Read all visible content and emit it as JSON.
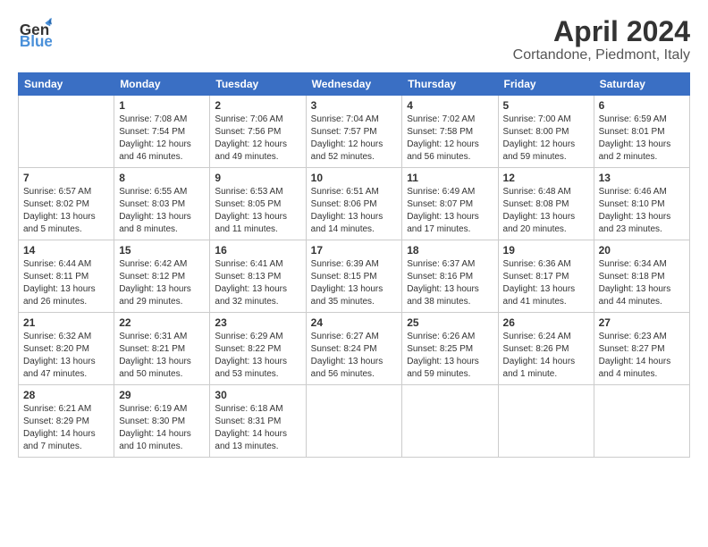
{
  "header": {
    "logo_line1": "General",
    "logo_line2": "Blue",
    "month_title": "April 2024",
    "location": "Cortandone, Piedmont, Italy"
  },
  "days_of_week": [
    "Sunday",
    "Monday",
    "Tuesday",
    "Wednesday",
    "Thursday",
    "Friday",
    "Saturday"
  ],
  "weeks": [
    [
      {
        "day": "",
        "info": ""
      },
      {
        "day": "1",
        "info": "Sunrise: 7:08 AM\nSunset: 7:54 PM\nDaylight: 12 hours\nand 46 minutes."
      },
      {
        "day": "2",
        "info": "Sunrise: 7:06 AM\nSunset: 7:56 PM\nDaylight: 12 hours\nand 49 minutes."
      },
      {
        "day": "3",
        "info": "Sunrise: 7:04 AM\nSunset: 7:57 PM\nDaylight: 12 hours\nand 52 minutes."
      },
      {
        "day": "4",
        "info": "Sunrise: 7:02 AM\nSunset: 7:58 PM\nDaylight: 12 hours\nand 56 minutes."
      },
      {
        "day": "5",
        "info": "Sunrise: 7:00 AM\nSunset: 8:00 PM\nDaylight: 12 hours\nand 59 minutes."
      },
      {
        "day": "6",
        "info": "Sunrise: 6:59 AM\nSunset: 8:01 PM\nDaylight: 13 hours\nand 2 minutes."
      }
    ],
    [
      {
        "day": "7",
        "info": "Sunrise: 6:57 AM\nSunset: 8:02 PM\nDaylight: 13 hours\nand 5 minutes."
      },
      {
        "day": "8",
        "info": "Sunrise: 6:55 AM\nSunset: 8:03 PM\nDaylight: 13 hours\nand 8 minutes."
      },
      {
        "day": "9",
        "info": "Sunrise: 6:53 AM\nSunset: 8:05 PM\nDaylight: 13 hours\nand 11 minutes."
      },
      {
        "day": "10",
        "info": "Sunrise: 6:51 AM\nSunset: 8:06 PM\nDaylight: 13 hours\nand 14 minutes."
      },
      {
        "day": "11",
        "info": "Sunrise: 6:49 AM\nSunset: 8:07 PM\nDaylight: 13 hours\nand 17 minutes."
      },
      {
        "day": "12",
        "info": "Sunrise: 6:48 AM\nSunset: 8:08 PM\nDaylight: 13 hours\nand 20 minutes."
      },
      {
        "day": "13",
        "info": "Sunrise: 6:46 AM\nSunset: 8:10 PM\nDaylight: 13 hours\nand 23 minutes."
      }
    ],
    [
      {
        "day": "14",
        "info": "Sunrise: 6:44 AM\nSunset: 8:11 PM\nDaylight: 13 hours\nand 26 minutes."
      },
      {
        "day": "15",
        "info": "Sunrise: 6:42 AM\nSunset: 8:12 PM\nDaylight: 13 hours\nand 29 minutes."
      },
      {
        "day": "16",
        "info": "Sunrise: 6:41 AM\nSunset: 8:13 PM\nDaylight: 13 hours\nand 32 minutes."
      },
      {
        "day": "17",
        "info": "Sunrise: 6:39 AM\nSunset: 8:15 PM\nDaylight: 13 hours\nand 35 minutes."
      },
      {
        "day": "18",
        "info": "Sunrise: 6:37 AM\nSunset: 8:16 PM\nDaylight: 13 hours\nand 38 minutes."
      },
      {
        "day": "19",
        "info": "Sunrise: 6:36 AM\nSunset: 8:17 PM\nDaylight: 13 hours\nand 41 minutes."
      },
      {
        "day": "20",
        "info": "Sunrise: 6:34 AM\nSunset: 8:18 PM\nDaylight: 13 hours\nand 44 minutes."
      }
    ],
    [
      {
        "day": "21",
        "info": "Sunrise: 6:32 AM\nSunset: 8:20 PM\nDaylight: 13 hours\nand 47 minutes."
      },
      {
        "day": "22",
        "info": "Sunrise: 6:31 AM\nSunset: 8:21 PM\nDaylight: 13 hours\nand 50 minutes."
      },
      {
        "day": "23",
        "info": "Sunrise: 6:29 AM\nSunset: 8:22 PM\nDaylight: 13 hours\nand 53 minutes."
      },
      {
        "day": "24",
        "info": "Sunrise: 6:27 AM\nSunset: 8:24 PM\nDaylight: 13 hours\nand 56 minutes."
      },
      {
        "day": "25",
        "info": "Sunrise: 6:26 AM\nSunset: 8:25 PM\nDaylight: 13 hours\nand 59 minutes."
      },
      {
        "day": "26",
        "info": "Sunrise: 6:24 AM\nSunset: 8:26 PM\nDaylight: 14 hours\nand 1 minute."
      },
      {
        "day": "27",
        "info": "Sunrise: 6:23 AM\nSunset: 8:27 PM\nDaylight: 14 hours\nand 4 minutes."
      }
    ],
    [
      {
        "day": "28",
        "info": "Sunrise: 6:21 AM\nSunset: 8:29 PM\nDaylight: 14 hours\nand 7 minutes."
      },
      {
        "day": "29",
        "info": "Sunrise: 6:19 AM\nSunset: 8:30 PM\nDaylight: 14 hours\nand 10 minutes."
      },
      {
        "day": "30",
        "info": "Sunrise: 6:18 AM\nSunset: 8:31 PM\nDaylight: 14 hours\nand 13 minutes."
      },
      {
        "day": "",
        "info": ""
      },
      {
        "day": "",
        "info": ""
      },
      {
        "day": "",
        "info": ""
      },
      {
        "day": "",
        "info": ""
      }
    ]
  ]
}
